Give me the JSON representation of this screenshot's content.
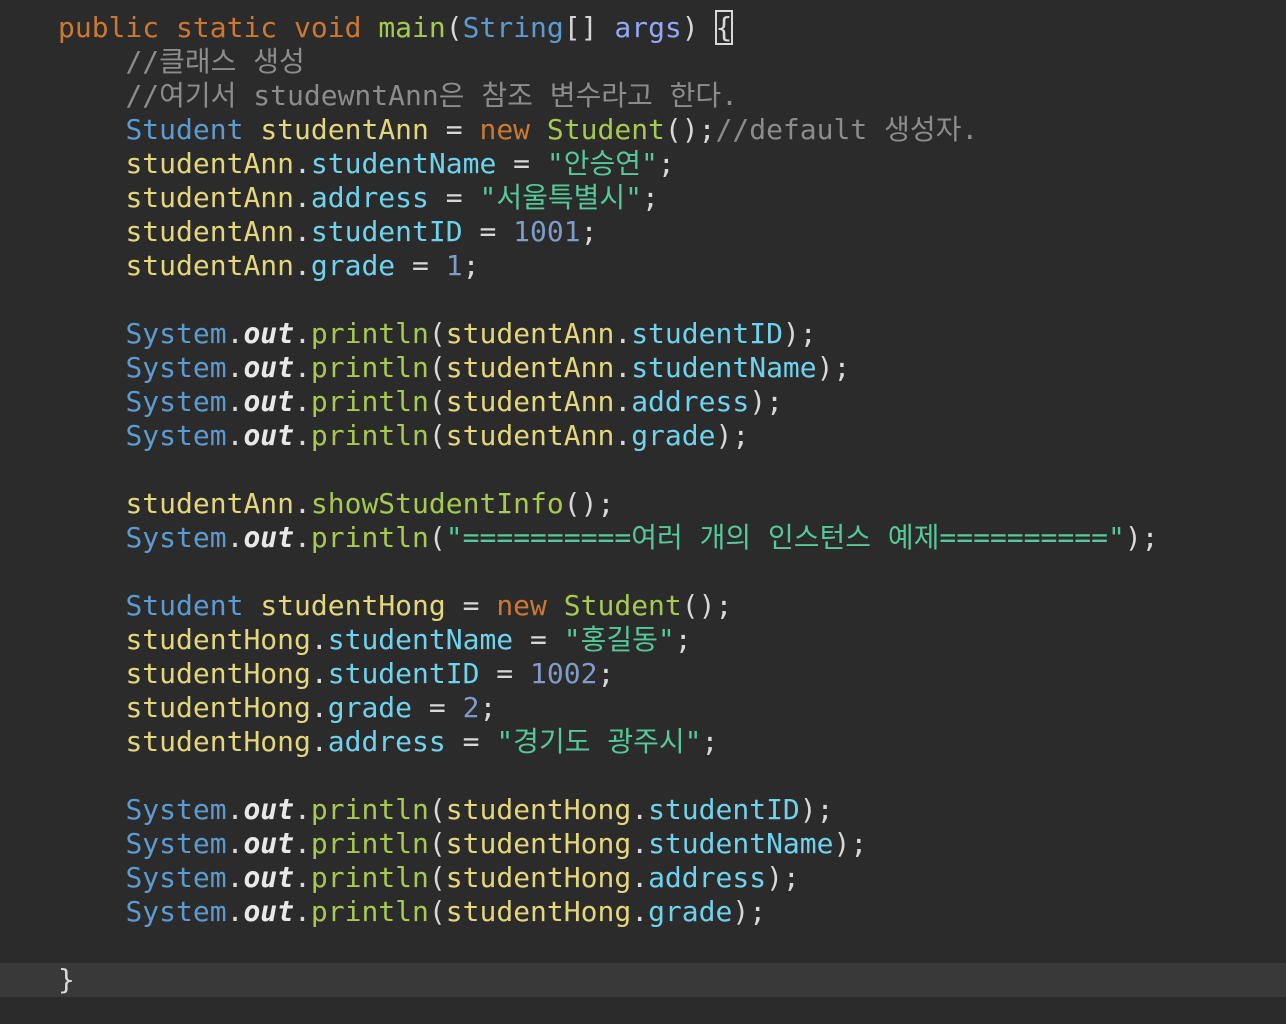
{
  "editor": {
    "theme_colors": {
      "background": "#2b2b2b",
      "current_line": "#393939",
      "keyword": "#cc7832",
      "method": "#a6c94f",
      "type": "#5b9bd1",
      "parameter": "#91a8f8",
      "comment": "#8c8c8c",
      "variable": "#e4d67a",
      "field": "#6fd3ee",
      "string": "#55c99a",
      "number": "#7f9bc7"
    },
    "lines": [
      {
        "indent": 0,
        "tokens": [
          {
            "t": "public",
            "c": "kw"
          },
          {
            "t": " ",
            "c": "punc"
          },
          {
            "t": "static",
            "c": "kw"
          },
          {
            "t": " ",
            "c": "punc"
          },
          {
            "t": "void",
            "c": "kw"
          },
          {
            "t": " ",
            "c": "punc"
          },
          {
            "t": "main",
            "c": "fn"
          },
          {
            "t": "(",
            "c": "punc"
          },
          {
            "t": "String",
            "c": "type"
          },
          {
            "t": "[] ",
            "c": "punc"
          },
          {
            "t": "args",
            "c": "param"
          },
          {
            "t": ") ",
            "c": "punc"
          },
          {
            "t": "{",
            "c": "punc brace-match"
          }
        ]
      },
      {
        "indent": 1,
        "tokens": [
          {
            "t": "//클래스 생성",
            "c": "cmt"
          }
        ]
      },
      {
        "indent": 1,
        "tokens": [
          {
            "t": "//여기서 studewntAnn은 참조 변수라고 한다.",
            "c": "cmt"
          }
        ]
      },
      {
        "indent": 1,
        "tokens": [
          {
            "t": "Student",
            "c": "type"
          },
          {
            "t": " ",
            "c": "punc"
          },
          {
            "t": "studentAnn",
            "c": "var"
          },
          {
            "t": " = ",
            "c": "punc"
          },
          {
            "t": "new",
            "c": "kw"
          },
          {
            "t": " ",
            "c": "punc"
          },
          {
            "t": "Student",
            "c": "fn"
          },
          {
            "t": "();",
            "c": "punc"
          },
          {
            "t": "//default 생성자.",
            "c": "cmt"
          }
        ]
      },
      {
        "indent": 1,
        "tokens": [
          {
            "t": "studentAnn",
            "c": "var"
          },
          {
            "t": ".",
            "c": "punc"
          },
          {
            "t": "studentName",
            "c": "field"
          },
          {
            "t": " = ",
            "c": "punc"
          },
          {
            "t": "\"안승연\"",
            "c": "str"
          },
          {
            "t": ";",
            "c": "punc"
          }
        ]
      },
      {
        "indent": 1,
        "tokens": [
          {
            "t": "studentAnn",
            "c": "var"
          },
          {
            "t": ".",
            "c": "punc"
          },
          {
            "t": "address",
            "c": "field"
          },
          {
            "t": " = ",
            "c": "punc"
          },
          {
            "t": "\"서울특별시\"",
            "c": "str"
          },
          {
            "t": ";",
            "c": "punc"
          }
        ]
      },
      {
        "indent": 1,
        "tokens": [
          {
            "t": "studentAnn",
            "c": "var"
          },
          {
            "t": ".",
            "c": "punc"
          },
          {
            "t": "studentID",
            "c": "field"
          },
          {
            "t": " = ",
            "c": "punc"
          },
          {
            "t": "1001",
            "c": "num"
          },
          {
            "t": ";",
            "c": "punc"
          }
        ]
      },
      {
        "indent": 1,
        "tokens": [
          {
            "t": "studentAnn",
            "c": "var"
          },
          {
            "t": ".",
            "c": "punc"
          },
          {
            "t": "grade",
            "c": "field"
          },
          {
            "t": " = ",
            "c": "punc"
          },
          {
            "t": "1",
            "c": "num"
          },
          {
            "t": ";",
            "c": "punc"
          }
        ]
      },
      {
        "indent": 0,
        "tokens": []
      },
      {
        "indent": 1,
        "tokens": [
          {
            "t": "System",
            "c": "type"
          },
          {
            "t": ".",
            "c": "punc"
          },
          {
            "t": "out",
            "c": "static"
          },
          {
            "t": ".",
            "c": "punc"
          },
          {
            "t": "println",
            "c": "fn"
          },
          {
            "t": "(",
            "c": "punc"
          },
          {
            "t": "studentAnn",
            "c": "var"
          },
          {
            "t": ".",
            "c": "punc"
          },
          {
            "t": "studentID",
            "c": "field"
          },
          {
            "t": ");",
            "c": "punc"
          }
        ]
      },
      {
        "indent": 1,
        "tokens": [
          {
            "t": "System",
            "c": "type"
          },
          {
            "t": ".",
            "c": "punc"
          },
          {
            "t": "out",
            "c": "static"
          },
          {
            "t": ".",
            "c": "punc"
          },
          {
            "t": "println",
            "c": "fn"
          },
          {
            "t": "(",
            "c": "punc"
          },
          {
            "t": "studentAnn",
            "c": "var"
          },
          {
            "t": ".",
            "c": "punc"
          },
          {
            "t": "studentName",
            "c": "field"
          },
          {
            "t": ");",
            "c": "punc"
          }
        ]
      },
      {
        "indent": 1,
        "tokens": [
          {
            "t": "System",
            "c": "type"
          },
          {
            "t": ".",
            "c": "punc"
          },
          {
            "t": "out",
            "c": "static"
          },
          {
            "t": ".",
            "c": "punc"
          },
          {
            "t": "println",
            "c": "fn"
          },
          {
            "t": "(",
            "c": "punc"
          },
          {
            "t": "studentAnn",
            "c": "var"
          },
          {
            "t": ".",
            "c": "punc"
          },
          {
            "t": "address",
            "c": "field"
          },
          {
            "t": ");",
            "c": "punc"
          }
        ]
      },
      {
        "indent": 1,
        "tokens": [
          {
            "t": "System",
            "c": "type"
          },
          {
            "t": ".",
            "c": "punc"
          },
          {
            "t": "out",
            "c": "static"
          },
          {
            "t": ".",
            "c": "punc"
          },
          {
            "t": "println",
            "c": "fn"
          },
          {
            "t": "(",
            "c": "punc"
          },
          {
            "t": "studentAnn",
            "c": "var"
          },
          {
            "t": ".",
            "c": "punc"
          },
          {
            "t": "grade",
            "c": "field"
          },
          {
            "t": ");",
            "c": "punc"
          }
        ]
      },
      {
        "indent": 0,
        "tokens": []
      },
      {
        "indent": 1,
        "tokens": [
          {
            "t": "studentAnn",
            "c": "var"
          },
          {
            "t": ".",
            "c": "punc"
          },
          {
            "t": "showStudentInfo",
            "c": "fn"
          },
          {
            "t": "();",
            "c": "punc"
          }
        ]
      },
      {
        "indent": 1,
        "tokens": [
          {
            "t": "System",
            "c": "type"
          },
          {
            "t": ".",
            "c": "punc"
          },
          {
            "t": "out",
            "c": "static"
          },
          {
            "t": ".",
            "c": "punc"
          },
          {
            "t": "println",
            "c": "fn"
          },
          {
            "t": "(",
            "c": "punc"
          },
          {
            "t": "\"==========여러 개의 인스턴스 예제==========\"",
            "c": "str"
          },
          {
            "t": ");",
            "c": "punc"
          }
        ]
      },
      {
        "indent": 0,
        "tokens": []
      },
      {
        "indent": 1,
        "tokens": [
          {
            "t": "Student",
            "c": "type"
          },
          {
            "t": " ",
            "c": "punc"
          },
          {
            "t": "studentHong",
            "c": "var"
          },
          {
            "t": " = ",
            "c": "punc"
          },
          {
            "t": "new",
            "c": "kw"
          },
          {
            "t": " ",
            "c": "punc"
          },
          {
            "t": "Student",
            "c": "fn"
          },
          {
            "t": "();",
            "c": "punc"
          }
        ]
      },
      {
        "indent": 1,
        "tokens": [
          {
            "t": "studentHong",
            "c": "var"
          },
          {
            "t": ".",
            "c": "punc"
          },
          {
            "t": "studentName",
            "c": "field"
          },
          {
            "t": " = ",
            "c": "punc"
          },
          {
            "t": "\"홍길동\"",
            "c": "str"
          },
          {
            "t": ";",
            "c": "punc"
          }
        ]
      },
      {
        "indent": 1,
        "tokens": [
          {
            "t": "studentHong",
            "c": "var"
          },
          {
            "t": ".",
            "c": "punc"
          },
          {
            "t": "studentID",
            "c": "field"
          },
          {
            "t": " = ",
            "c": "punc"
          },
          {
            "t": "1002",
            "c": "num"
          },
          {
            "t": ";",
            "c": "punc"
          }
        ]
      },
      {
        "indent": 1,
        "tokens": [
          {
            "t": "studentHong",
            "c": "var"
          },
          {
            "t": ".",
            "c": "punc"
          },
          {
            "t": "grade",
            "c": "field"
          },
          {
            "t": " = ",
            "c": "punc"
          },
          {
            "t": "2",
            "c": "num"
          },
          {
            "t": ";",
            "c": "punc"
          }
        ]
      },
      {
        "indent": 1,
        "tokens": [
          {
            "t": "studentHong",
            "c": "var"
          },
          {
            "t": ".",
            "c": "punc"
          },
          {
            "t": "address",
            "c": "field"
          },
          {
            "t": " = ",
            "c": "punc"
          },
          {
            "t": "\"경기도 광주시\"",
            "c": "str"
          },
          {
            "t": ";",
            "c": "punc"
          }
        ]
      },
      {
        "indent": 0,
        "tokens": []
      },
      {
        "indent": 1,
        "tokens": [
          {
            "t": "System",
            "c": "type"
          },
          {
            "t": ".",
            "c": "punc"
          },
          {
            "t": "out",
            "c": "static"
          },
          {
            "t": ".",
            "c": "punc"
          },
          {
            "t": "println",
            "c": "fn"
          },
          {
            "t": "(",
            "c": "punc"
          },
          {
            "t": "studentHong",
            "c": "var"
          },
          {
            "t": ".",
            "c": "punc"
          },
          {
            "t": "studentID",
            "c": "field"
          },
          {
            "t": ");",
            "c": "punc"
          }
        ]
      },
      {
        "indent": 1,
        "tokens": [
          {
            "t": "System",
            "c": "type"
          },
          {
            "t": ".",
            "c": "punc"
          },
          {
            "t": "out",
            "c": "static"
          },
          {
            "t": ".",
            "c": "punc"
          },
          {
            "t": "println",
            "c": "fn"
          },
          {
            "t": "(",
            "c": "punc"
          },
          {
            "t": "studentHong",
            "c": "var"
          },
          {
            "t": ".",
            "c": "punc"
          },
          {
            "t": "studentName",
            "c": "field"
          },
          {
            "t": ");",
            "c": "punc"
          }
        ]
      },
      {
        "indent": 1,
        "tokens": [
          {
            "t": "System",
            "c": "type"
          },
          {
            "t": ".",
            "c": "punc"
          },
          {
            "t": "out",
            "c": "static"
          },
          {
            "t": ".",
            "c": "punc"
          },
          {
            "t": "println",
            "c": "fn"
          },
          {
            "t": "(",
            "c": "punc"
          },
          {
            "t": "studentHong",
            "c": "var"
          },
          {
            "t": ".",
            "c": "punc"
          },
          {
            "t": "address",
            "c": "field"
          },
          {
            "t": ");",
            "c": "punc"
          }
        ]
      },
      {
        "indent": 1,
        "tokens": [
          {
            "t": "System",
            "c": "type"
          },
          {
            "t": ".",
            "c": "punc"
          },
          {
            "t": "out",
            "c": "static"
          },
          {
            "t": ".",
            "c": "punc"
          },
          {
            "t": "println",
            "c": "fn"
          },
          {
            "t": "(",
            "c": "punc"
          },
          {
            "t": "studentHong",
            "c": "var"
          },
          {
            "t": ".",
            "c": "punc"
          },
          {
            "t": "grade",
            "c": "field"
          },
          {
            "t": ");",
            "c": "punc"
          }
        ]
      },
      {
        "indent": 0,
        "tokens": []
      },
      {
        "indent": 0,
        "current": true,
        "tokens": [
          {
            "t": "}",
            "c": "punc"
          }
        ]
      }
    ]
  }
}
